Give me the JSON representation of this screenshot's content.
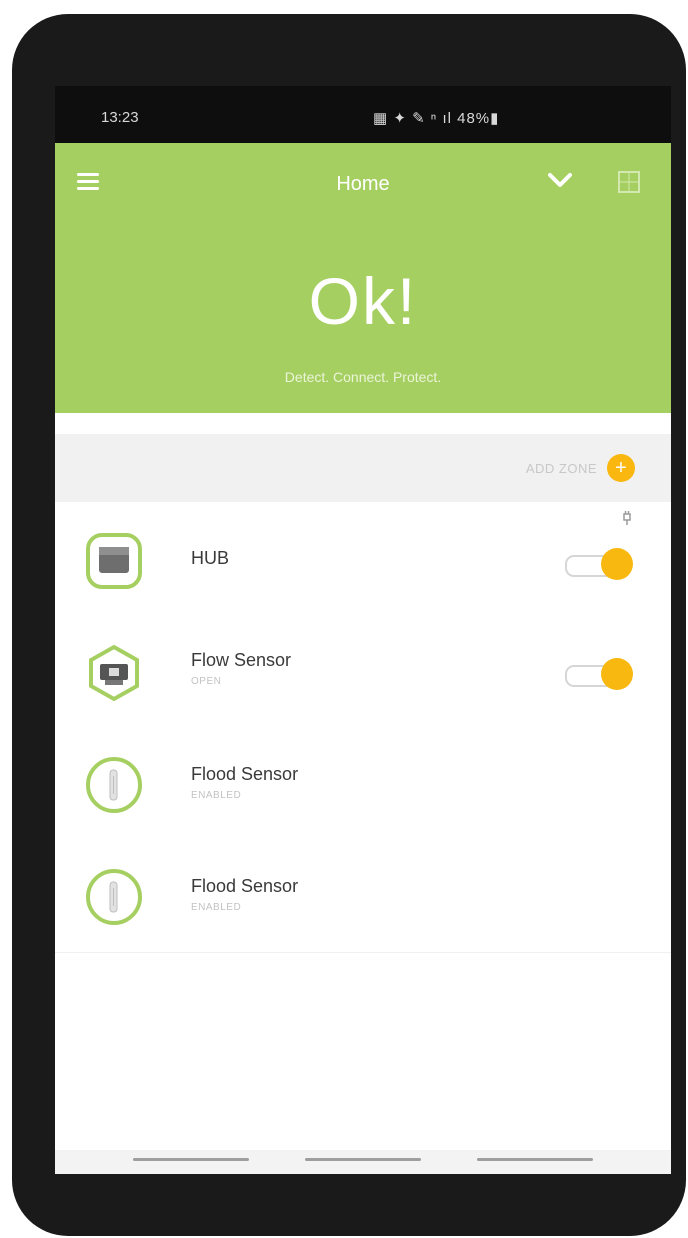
{
  "status_bar": {
    "time": "13:23",
    "icons": "▦ ✦ ✎ ⁿ ıl 48%▮"
  },
  "header": {
    "title": "Home",
    "status_big": "Ok!",
    "tagline": "Detect. Connect. Protect."
  },
  "zones": {
    "add_zone_label": "ADD ZONE",
    "add_icon": "+"
  },
  "devices": [
    {
      "name": "HUB",
      "status": "",
      "has_toggle": true,
      "toggle_on": true
    },
    {
      "name": "Flow Sensor",
      "status": "OPEN",
      "has_toggle": true,
      "toggle_on": true
    },
    {
      "name": "Flood Sensor",
      "status": "ENABLED",
      "has_toggle": false
    },
    {
      "name": "Flood Sensor",
      "status": "ENABLED",
      "has_toggle": false
    }
  ],
  "colors": {
    "brand_green": "#a6cf62",
    "accent_yellow": "#f8b810",
    "phone_body": "#1a1a1a"
  }
}
